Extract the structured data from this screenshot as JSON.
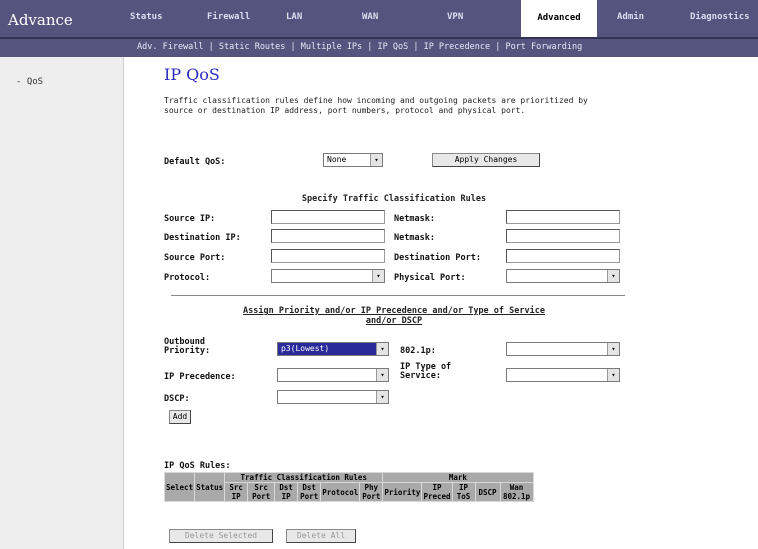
{
  "brand": "Advance",
  "nav": {
    "tabs": [
      "Status",
      "Firewall",
      "LAN",
      "WAN",
      "VPN",
      "Advanced",
      "Admin",
      "Diagnostics"
    ],
    "sub_links": "Adv. Firewall | Static Routes | Multiple IPs | IP QoS | IP Precedence | Port Forwarding"
  },
  "sidebar": {
    "item": "- QoS"
  },
  "page": {
    "title": "IP QoS",
    "description": "Traffic classification rules define how incoming and outgoing packets are prioritized by source or destination IP address, port numbers, protocol and physical port."
  },
  "default_qos": {
    "label": "Default QoS:",
    "value": "None",
    "apply_button": "Apply Changes"
  },
  "classification": {
    "heading": "Specify Traffic Classification Rules",
    "source_ip_label": "Source IP:",
    "source_netmask_label": "Netmask:",
    "dest_ip_label": "Destination IP:",
    "dest_netmask_label": "Netmask:",
    "source_port_label": "Source Port:",
    "dest_port_label": "Destination Port:",
    "protocol_label": "Protocol:",
    "physical_port_label": "Physical Port:"
  },
  "action": {
    "heading_line1": "Assign Priority and/or IP Precedence and/or Type of Service",
    "heading_line2": "and/or DSCP",
    "outbound_label": "Outbound Priority:",
    "outbound_value": "p3(Lowest)",
    "vlan_label": "802.1p:",
    "precedence_label": "IP Precedence:",
    "tos_label": "IP Type of Service:",
    "dscp_label": "DSCP:",
    "add_button": "Add"
  },
  "rules": {
    "caption": "IP QoS Rules:",
    "group_traffic": "Traffic Classification Rules",
    "group_mark": "Mark",
    "columns": [
      "Select",
      "Status",
      "Src IP",
      "Src Port",
      "Dst IP",
      "Dst Port",
      "Protocol",
      "Phy Port",
      "Priority",
      "IP Preced",
      "IP ToS",
      "DSCP",
      "Wan 802.1p"
    ],
    "delete_selected": "Delete Selected",
    "delete_all": "Delete All"
  }
}
